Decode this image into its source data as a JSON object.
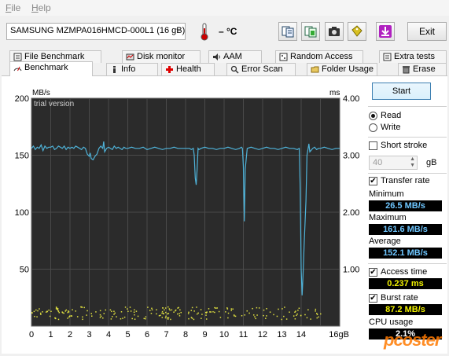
{
  "menu": {
    "file": {
      "u": "F",
      "rest": "ile"
    },
    "help": {
      "u": "H",
      "rest": "elp"
    }
  },
  "toolbar": {
    "drive": "SAMSUNG MZMPA016HMCD-000L1 (16 gB)",
    "temperature": "– °C",
    "icons": [
      "copy-text-icon",
      "copy-info-icon",
      "screenshot-icon",
      "health-options-icon",
      "save-icon"
    ],
    "exit_label": "Exit"
  },
  "tabs_top": [
    "File Benchmark",
    "Disk monitor",
    "AAM",
    "Random Access",
    "Extra tests"
  ],
  "tabs_bottom": [
    "Benchmark",
    "Info",
    "Health",
    "Error Scan",
    "Folder Usage",
    "Erase"
  ],
  "chart_data": {
    "type": "line",
    "watermark_text": "trial version",
    "y_left_label": "MB/s",
    "y_right_label": "ms",
    "x_ticks": [
      "0",
      "1",
      "2",
      "3",
      "4",
      "5",
      "6",
      "7",
      "8",
      "9",
      "10",
      "11",
      "12",
      "13",
      "14",
      "16gB"
    ],
    "y_left_ticks": [
      "200",
      "150",
      "100",
      "50"
    ],
    "y_right_ticks": [
      "4.00",
      "3.00",
      "2.00",
      "1.00"
    ],
    "xlim": [
      0,
      16
    ],
    "ylim_left": [
      0,
      200
    ],
    "ylim_right": [
      0,
      4
    ],
    "series": [
      {
        "color": "#4fb3d9",
        "x": [
          0,
          0.1,
          0.2,
          0.3,
          0.4,
          0.5,
          0.6,
          0.7,
          0.8,
          0.9,
          1.0,
          1.1,
          1.2,
          1.3,
          1.4,
          1.5,
          1.6,
          1.7,
          1.8,
          1.9,
          2.0,
          2.1,
          2.2,
          2.3,
          2.4,
          2.5,
          2.6,
          2.7,
          2.8,
          2.9,
          3.0,
          3.05,
          3.1,
          3.2,
          3.3,
          3.4,
          3.5,
          3.6,
          3.7,
          3.75,
          3.8,
          3.9,
          4.0,
          4.1,
          4.2,
          4.3,
          4.4,
          4.5,
          4.6,
          4.7,
          4.8,
          4.9,
          5.0,
          5.2,
          5.4,
          5.6,
          5.8,
          6.0,
          6.2,
          6.4,
          6.6,
          6.8,
          7.0,
          7.2,
          7.4,
          7.6,
          7.8,
          8.0,
          8.2,
          8.3,
          8.4,
          8.45,
          8.5,
          8.55,
          8.6,
          8.65,
          8.7,
          8.8,
          9.0,
          9.2,
          9.4,
          9.6,
          9.8,
          10.0,
          10.2,
          10.4,
          10.6,
          10.8,
          10.9,
          10.95,
          11.0,
          11.05,
          11.1,
          11.2,
          11.4,
          11.6,
          11.8,
          12.0,
          12.2,
          12.4,
          12.6,
          12.8,
          13.0,
          13.2,
          13.4,
          13.6,
          13.8,
          13.9,
          13.95,
          14.0,
          14.05,
          14.1,
          14.15,
          14.2,
          14.25,
          14.3,
          14.35,
          14.4,
          14.45,
          14.5,
          14.6,
          14.7,
          14.8,
          14.9,
          15.0,
          15.2,
          15.4,
          15.6,
          15.8,
          16.0
        ],
        "y": [
          156,
          158,
          155,
          157,
          156,
          159,
          154,
          158,
          156,
          157,
          157,
          158,
          155,
          156,
          158,
          157,
          156,
          158,
          155,
          157,
          156,
          157,
          156,
          158,
          157,
          156,
          155,
          157,
          156,
          151,
          149,
          152,
          147,
          146,
          149,
          151,
          156,
          158,
          156,
          162,
          153,
          156,
          157,
          156,
          155,
          158,
          156,
          157,
          156,
          155,
          157,
          156,
          156,
          157,
          156,
          156,
          157,
          155,
          156,
          157,
          156,
          155,
          156,
          156,
          157,
          156,
          156,
          156,
          156,
          155,
          156,
          150,
          130,
          124,
          138,
          156,
          155,
          156,
          157,
          156,
          156,
          155,
          156,
          156,
          157,
          156,
          155,
          156,
          157,
          156,
          140,
          92,
          138,
          156,
          157,
          156,
          155,
          156,
          157,
          156,
          156,
          155,
          156,
          157,
          156,
          156,
          155,
          156,
          120,
          50,
          27,
          45,
          70,
          90,
          110,
          150,
          155,
          160,
          153,
          154,
          156,
          157,
          155,
          156,
          156,
          157,
          156,
          155,
          156,
          156
        ]
      }
    ],
    "access_series_color": "#e0e040",
    "access_time_level_ms": 0.237,
    "burst_series_color": "#e0e040"
  },
  "side": {
    "start_label": "Start",
    "read_label": "Read",
    "write_label": "Write",
    "short_stroke_label": "Short stroke",
    "stroke_value": "40",
    "stroke_unit": "gB",
    "transfer_rate_label": "Transfer rate",
    "minimum_label": "Minimum",
    "minimum_value": "26.5 MB/s",
    "maximum_label": "Maximum",
    "maximum_value": "161.6 MB/s",
    "average_label": "Average",
    "average_value": "152.1 MB/s",
    "access_time_label": "Access time",
    "access_time_value": "0.237 ms",
    "burst_rate_label": "Burst rate",
    "burst_rate_value": "87.2 MB/s",
    "cpu_usage_label": "CPU usage",
    "cpu_usage_value": "2.1%",
    "read_selected": true,
    "short_stroke_checked": false,
    "transfer_rate_checked": true,
    "access_time_checked": true,
    "burst_rate_checked": true
  },
  "watermark_site": "pcoster"
}
